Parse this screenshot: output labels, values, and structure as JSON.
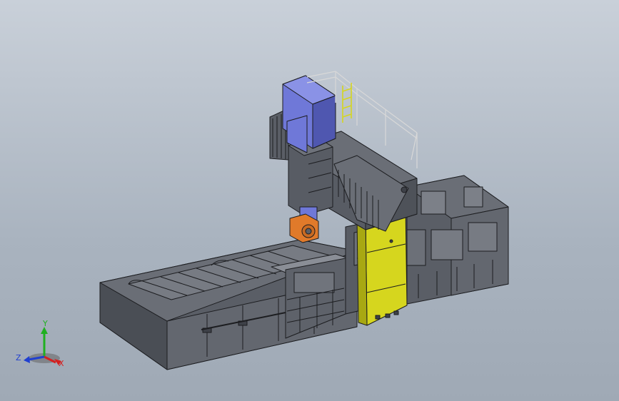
{
  "viewport": {
    "background_top": "#c9d0d9",
    "background_bottom": "#9fa9b5"
  },
  "model": {
    "colors": {
      "frame": "#5a5e66",
      "frame_dark": "#3e4148",
      "frame_light": "#70747c",
      "edge": "#1c1d20",
      "motor": "#6f78d8",
      "motor_dark": "#4f57b0",
      "spindle_head": "#e07a2a",
      "column": "#d6d61e",
      "rail": "#c9c420"
    }
  },
  "triad": {
    "labels": {
      "x": "X",
      "y": "Y",
      "z": "Z"
    },
    "colors": {
      "x": "#d42020",
      "y": "#20b020",
      "z": "#2040d0"
    }
  }
}
